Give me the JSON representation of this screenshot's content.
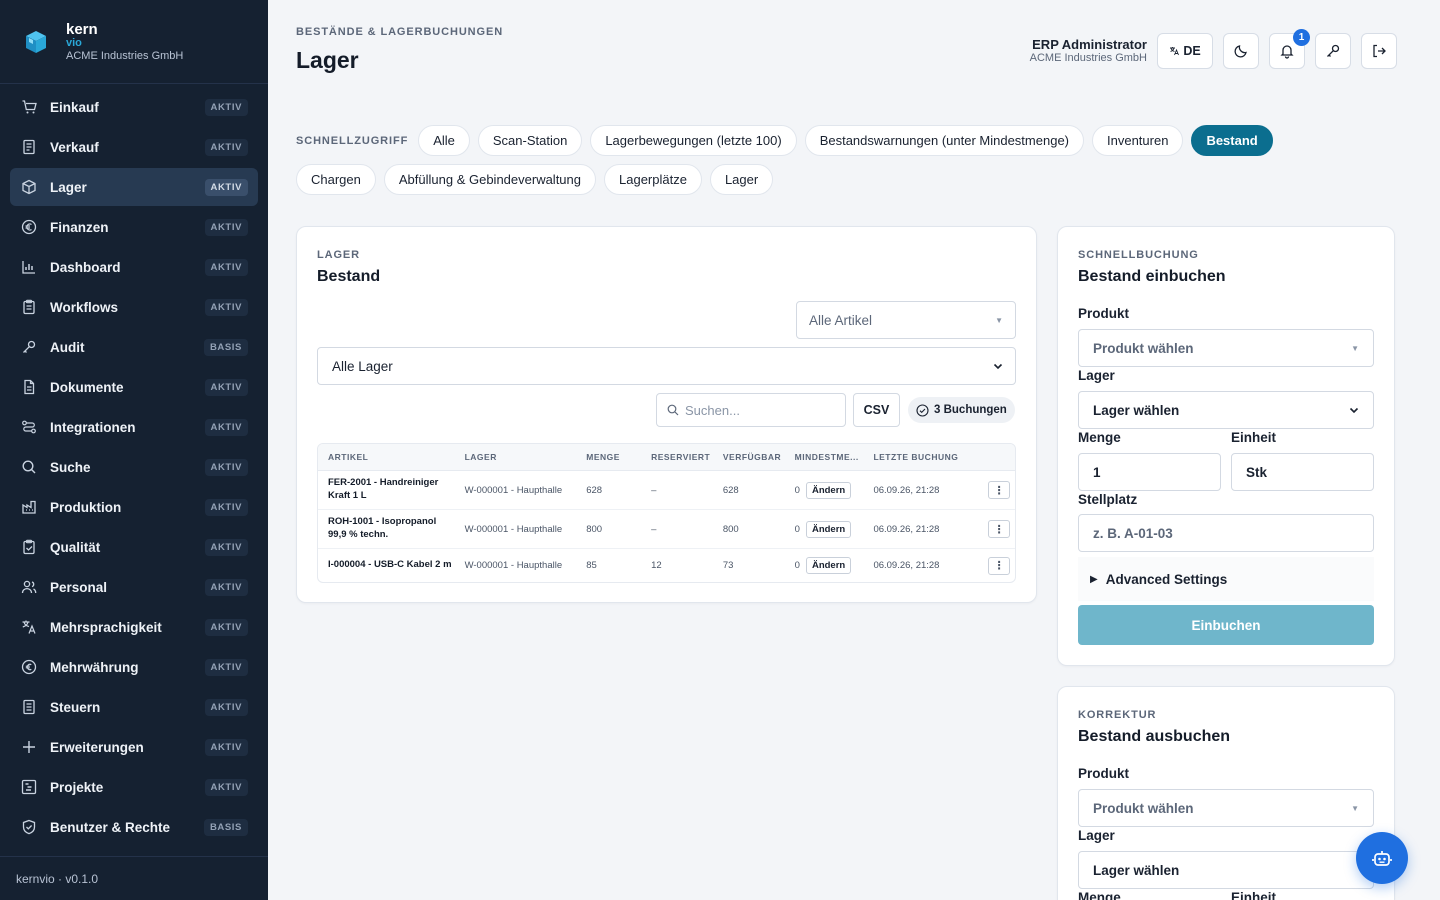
{
  "brand": {
    "name": "kern",
    "sub": "vio",
    "company": "ACME Industries GmbH"
  },
  "sidebar": {
    "items": [
      {
        "label": "Einkauf",
        "badge": "AKTIV",
        "icon": "cart-icon"
      },
      {
        "label": "Verkauf",
        "badge": "AKTIV",
        "icon": "receipt-icon"
      },
      {
        "label": "Lager",
        "badge": "AKTIV",
        "icon": "box-icon",
        "active": true
      },
      {
        "label": "Finanzen",
        "badge": "AKTIV",
        "icon": "euro-icon"
      },
      {
        "label": "Dashboard",
        "badge": "AKTIV",
        "icon": "bar-chart-icon"
      },
      {
        "label": "Workflows",
        "badge": "AKTIV",
        "icon": "clipboard-icon"
      },
      {
        "label": "Audit",
        "badge": "BASIS",
        "icon": "key-icon"
      },
      {
        "label": "Dokumente",
        "badge": "AKTIV",
        "icon": "document-icon"
      },
      {
        "label": "Integrationen",
        "badge": "AKTIV",
        "icon": "route-icon"
      },
      {
        "label": "Suche",
        "badge": "AKTIV",
        "icon": "search-icon"
      },
      {
        "label": "Produktion",
        "badge": "AKTIV",
        "icon": "factory-icon"
      },
      {
        "label": "Qualität",
        "badge": "AKTIV",
        "icon": "clipboard-check-icon"
      },
      {
        "label": "Personal",
        "badge": "AKTIV",
        "icon": "users-icon"
      },
      {
        "label": "Mehrsprachigkeit",
        "badge": "AKTIV",
        "icon": "translate-icon"
      },
      {
        "label": "Mehrwährung",
        "badge": "AKTIV",
        "icon": "currency-icon"
      },
      {
        "label": "Steuern",
        "badge": "AKTIV",
        "icon": "tax-document-icon"
      },
      {
        "label": "Erweiterungen",
        "badge": "AKTIV",
        "icon": "plus-icon"
      },
      {
        "label": "Projekte",
        "badge": "AKTIV",
        "icon": "gantt-icon"
      },
      {
        "label": "Benutzer & Rechte",
        "badge": "BASIS",
        "icon": "shield-icon"
      }
    ],
    "footer": "kernvio · v0.1.0"
  },
  "header": {
    "overline": "BESTÄNDE & LAGERBUCHUNGEN",
    "title": "Lager",
    "user_name": "ERP Administrator",
    "user_company": "ACME Industries GmbH",
    "lang": "DE",
    "notifications": "1"
  },
  "quick": {
    "label": "SCHNELLZUGRIFF",
    "chips": [
      "Alle",
      "Scan-Station",
      "Lagerbewegungen (letzte 100)",
      "Bestandswarnungen (unter Mindestmenge)",
      "Inventuren",
      "Bestand",
      "Chargen",
      "Abfüllung & Gebindeverwaltung",
      "Lagerplätze",
      "Lager"
    ],
    "active": "Bestand"
  },
  "main": {
    "overline": "LAGER",
    "title": "Bestand",
    "article_filter": "Alle Artikel",
    "warehouse_filter": "Alle Lager",
    "search_placeholder": "Suchen...",
    "csv": "CSV",
    "bookings": "3 Buchungen",
    "columns": [
      "ARTIKEL",
      "LAGER",
      "MENGE",
      "RESERVIERT",
      "VERFÜGBAR",
      "MINDESTME...",
      "LETZTE BUCHUNG",
      ""
    ],
    "rows": [
      {
        "article": "FER-2001 - Handreiniger Kraft 1 L",
        "warehouse": "W-000001 - Haupthalle",
        "qty": "628",
        "reserved": "–",
        "available": "628",
        "min": "0",
        "action": "Ändern",
        "last": "06.09.26, 21:28"
      },
      {
        "article": "ROH-1001 - Isopropanol 99,9 % techn.",
        "warehouse": "W-000001 - Haupthalle",
        "qty": "800",
        "reserved": "–",
        "available": "800",
        "min": "0",
        "action": "Ändern",
        "last": "06.09.26, 21:28"
      },
      {
        "article": "I-000004 - USB-C Kabel 2 m",
        "warehouse": "W-000001 - Haupthalle",
        "qty": "85",
        "reserved": "12",
        "available": "73",
        "min": "0",
        "action": "Ändern",
        "last": "06.09.26, 21:28"
      }
    ]
  },
  "book": {
    "overline": "SCHNELLBUCHUNG",
    "title": "Bestand einbuchen",
    "product_label": "Produkt",
    "product_placeholder": "Produkt wählen",
    "warehouse_label": "Lager",
    "warehouse_value": "Lager wählen",
    "qty_label": "Menge",
    "qty_value": "1",
    "unit_label": "Einheit",
    "unit_value": "Stk",
    "location_label": "Stellplatz",
    "location_placeholder": "z. B. A-01-03",
    "advanced": "Advanced Settings",
    "submit": "Einbuchen"
  },
  "correction": {
    "overline": "KORREKTUR",
    "title": "Bestand ausbuchen",
    "product_label": "Produkt",
    "product_placeholder": "Produkt wählen",
    "warehouse_label": "Lager",
    "warehouse_value": "Lager wählen",
    "qty_label": "Menge",
    "unit_label": "Einheit"
  },
  "colors": {
    "sidebar": "#152131",
    "accent": "#0b6e8f",
    "primary": "#1f6fe0",
    "submit_disabled": "#6fb6cb"
  }
}
